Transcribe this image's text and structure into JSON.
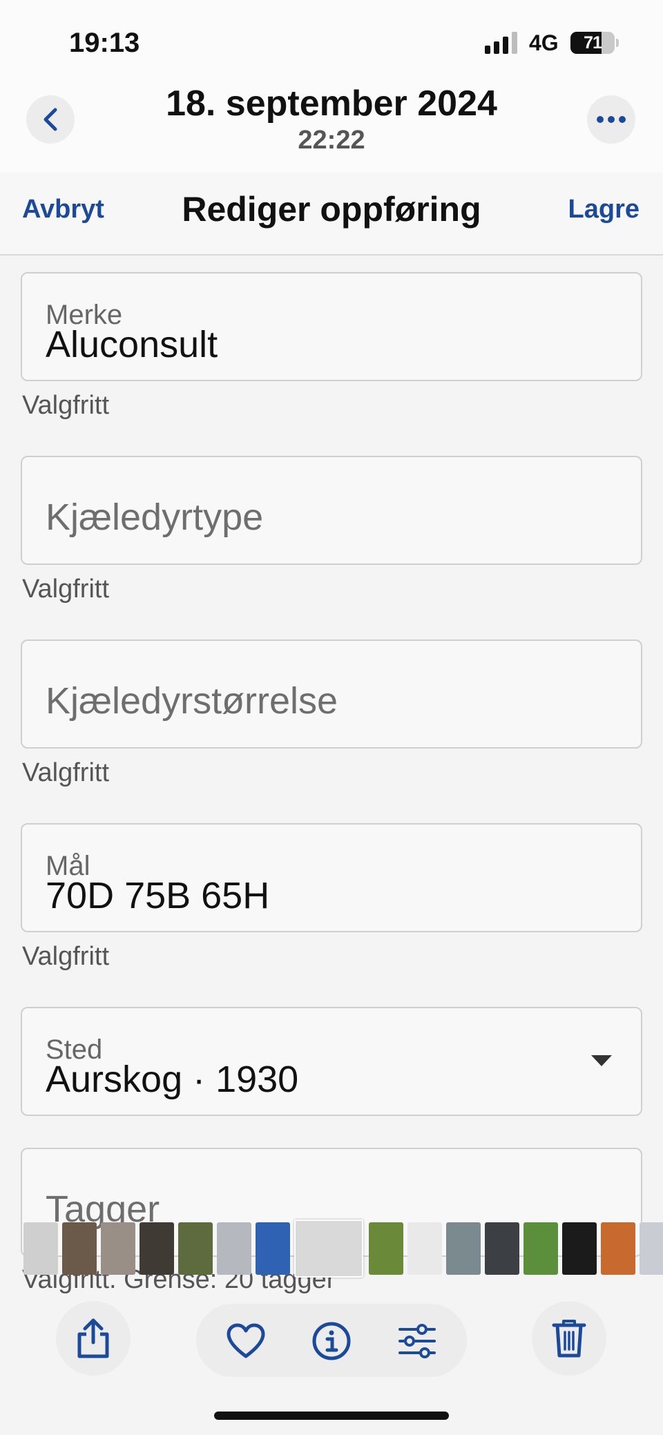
{
  "status_bar": {
    "time": "19:13",
    "network": "4G",
    "battery": "71",
    "battery_level": 0.71
  },
  "header": {
    "date": "18. september 2024",
    "time": "22:22"
  },
  "edit_bar": {
    "cancel": "Avbryt",
    "title": "Rediger oppføring",
    "save": "Lagre"
  },
  "form": {
    "brand": {
      "label": "Merke",
      "value": "Aluconsult",
      "helper": "Valgfritt"
    },
    "pet_type": {
      "placeholder": "Kjæledyrtype",
      "helper": "Valgfritt"
    },
    "pet_size": {
      "placeholder": "Kjæledyrstørrelse",
      "helper": "Valgfritt"
    },
    "size": {
      "label": "Mål",
      "value": "70D 75B 65H",
      "helper": "Valgfritt"
    },
    "location": {
      "label": "Sted",
      "value": "Aurskog · 1930"
    },
    "tags": {
      "placeholder": "Tagger",
      "helper": "Valgfritt. Grense: 20 tagger"
    }
  },
  "thumbnail_colors": [
    "#cfcfcf",
    "#6b5a4a",
    "#9a8f86",
    "#3f3a34",
    "#5e6b3e",
    "#b5b9bf",
    "#2f62b3",
    "#d9d9d9",
    "#6a8a3a",
    "#e9e9e9",
    "#7a8a8e",
    "#3c3f44",
    "#5b8f3c",
    "#1b1b1b",
    "#c8692f",
    "#c9ccd2"
  ]
}
